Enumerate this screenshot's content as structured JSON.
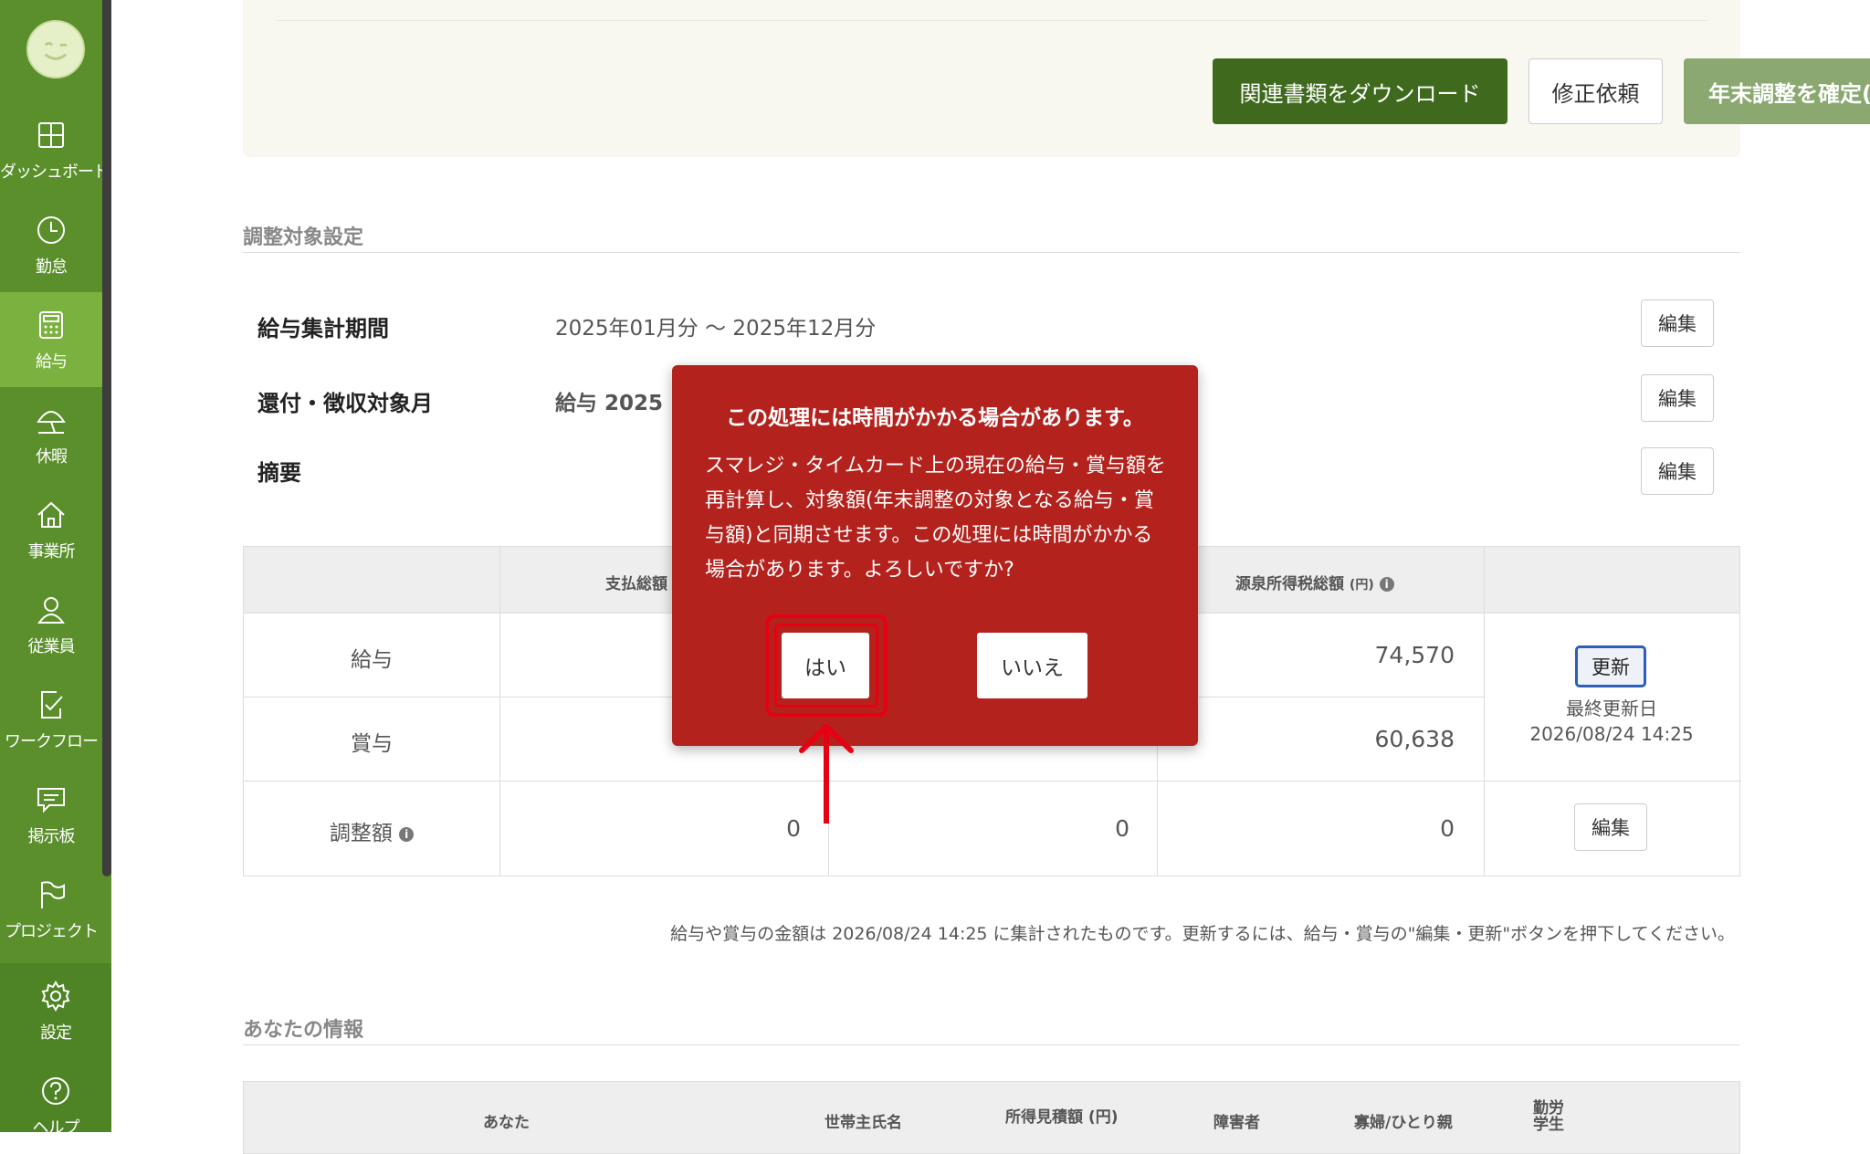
{
  "sidebar": {
    "items": [
      {
        "label": "ダッシュボード",
        "icon": "dashboard-icon"
      },
      {
        "label": "勤怠",
        "icon": "clock-icon"
      },
      {
        "label": "給与",
        "icon": "calculator-icon"
      },
      {
        "label": "休暇",
        "icon": "umbrella-icon"
      },
      {
        "label": "事業所",
        "icon": "home-icon"
      },
      {
        "label": "従業員",
        "icon": "user-icon"
      },
      {
        "label": "ワークフロー",
        "icon": "workflow-icon"
      },
      {
        "label": "掲示板",
        "icon": "message-icon"
      },
      {
        "label": "プロジェクト",
        "icon": "flag-icon"
      },
      {
        "label": "設定",
        "icon": "gear-icon"
      },
      {
        "label": "ヘルプ",
        "icon": "help-icon"
      }
    ],
    "active_index": 2
  },
  "actions": {
    "download": "関連書類をダウンロード",
    "request_fix": "修正依頼",
    "confirm": "年末調整を確定(確認)"
  },
  "settings": {
    "section_title": "調整対象設定",
    "rows": [
      {
        "label": "給与集計期間",
        "value": "2025年01月分 〜 2025年12月分",
        "edit": "編集"
      },
      {
        "label": "還付・徴収対象月",
        "value": "給与 2025",
        "edit": "編集"
      },
      {
        "label": "摘要",
        "value": "",
        "edit": "編集"
      }
    ]
  },
  "summary_table": {
    "headers": {
      "total_pay": "支払総額",
      "withholding": "源泉所得税総額",
      "withholding_unit": "(円)"
    },
    "rows": [
      {
        "label": "給与",
        "withholding": "74,570"
      },
      {
        "label": "賞与",
        "withholding": "60,638"
      },
      {
        "label": "調整額",
        "total_pay": "0",
        "col3": "0",
        "withholding": "0",
        "edit": "編集"
      }
    ],
    "update_button": "更新",
    "last_updated_label": "最終更新日",
    "last_updated_value": "2026/08/24 14:25"
  },
  "note": "給与や賞与の金額は 2026/08/24 14:25 に集計されたものです。更新するには、給与・賞与の\"編集・更新\"ボタンを押下してください。",
  "info_section": {
    "title": "あなたの情報",
    "headers": [
      "あなた",
      "世帯主氏名",
      "所得見積額 (円)",
      "障害者",
      "寡婦/ひとり親",
      "勤労学生"
    ]
  },
  "modal": {
    "title": "この処理には時間がかかる場合があります。",
    "body": "スマレジ・タイムカード上の現在の給与・賞与額を再計算し、対象額(年末調整の対象となる給与・賞与額)と同期させます。この処理には時間がかかる場合があります。よろしいですか?",
    "yes": "はい",
    "no": "いいえ"
  },
  "colors": {
    "sidebar": "#5a8f2c",
    "sidebar_active": "#7ab13f",
    "download_button": "#3f6a1e",
    "confirm_button": "#8aa870",
    "modal": "#b3221d",
    "highlight": "#e60012"
  }
}
